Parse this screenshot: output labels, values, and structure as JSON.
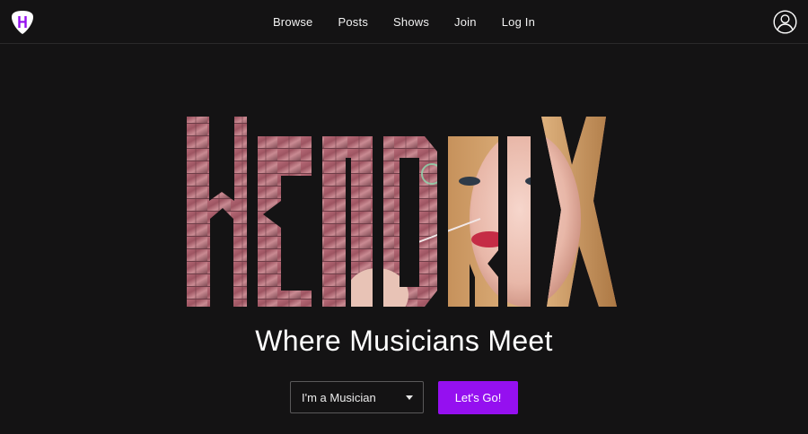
{
  "header": {
    "logo_icon": "guitar-pick-h-logo",
    "nav": [
      {
        "label": "Browse"
      },
      {
        "label": "Posts"
      },
      {
        "label": "Shows"
      },
      {
        "label": "Join"
      },
      {
        "label": "Log In"
      }
    ],
    "account_icon": "user-circle-icon"
  },
  "hero": {
    "wordmark": "HENDRIX",
    "tagline": "Where Musicians Meet"
  },
  "signup": {
    "role_select": {
      "selected": "I'm a Musician"
    },
    "submit_label": "Let's Go!"
  },
  "colors": {
    "background": "#141314",
    "accent": "#9510f0"
  }
}
